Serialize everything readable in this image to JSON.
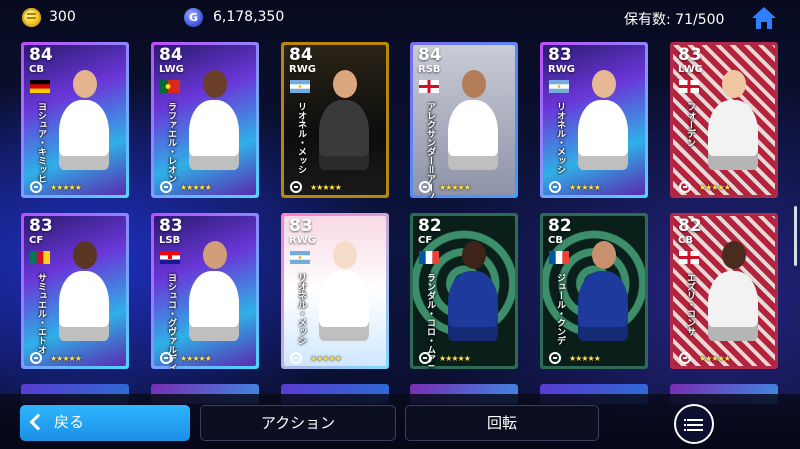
{
  "header": {
    "coins": "300",
    "gp": "6,178,350",
    "gp_icon_letter": "G",
    "holdings": "保有数: 71/500"
  },
  "cards": [
    {
      "rating": "84",
      "pos": "CB",
      "name": "ヨシュア・キミッヒ",
      "flag": "germany",
      "theme": "neon-purple"
    },
    {
      "rating": "84",
      "pos": "LWG",
      "name": "ラファエル・レオン",
      "flag": "portugal",
      "theme": "neon-purple"
    },
    {
      "rating": "84",
      "pos": "RWG",
      "name": "リオネル・メッシ",
      "flag": "argentina",
      "theme": "dark-gold"
    },
    {
      "rating": "84",
      "pos": "RSB",
      "name": "アレクサンダー＝アーノルド",
      "flag": "england",
      "theme": "grey-blue"
    },
    {
      "rating": "83",
      "pos": "RWG",
      "name": "リオネル・メッシ",
      "flag": "argentina",
      "theme": "neon-purple"
    },
    {
      "rating": "83",
      "pos": "LWG",
      "name": "フォーデン",
      "flag": "england",
      "theme": "red-pattern"
    },
    {
      "rating": "83",
      "pos": "CF",
      "name": "サミュエル・エトオ",
      "flag": "cameroon",
      "theme": "neon-purple"
    },
    {
      "rating": "83",
      "pos": "LSB",
      "name": "ヨシュコ・グヴァルディオル",
      "flag": "croatia",
      "theme": "neon-purple"
    },
    {
      "rating": "83",
      "pos": "RWG",
      "name": "リオネル・メッシ",
      "flag": "argentina",
      "theme": "anime"
    },
    {
      "rating": "82",
      "pos": "CF",
      "name": "ランダル・コロ・ムアニ",
      "flag": "france",
      "theme": "green-tunnel"
    },
    {
      "rating": "82",
      "pos": "CB",
      "name": "ジュール・クンデ",
      "flag": "france",
      "theme": "green-tunnel"
    },
    {
      "rating": "82",
      "pos": "CB",
      "name": "エズリ・コンサ",
      "flag": "england",
      "theme": "red-pattern"
    }
  ],
  "stars": "★★★★★",
  "buttons": {
    "back": "戻る",
    "action": "アクション",
    "rotate": "回転"
  },
  "icons": [
    "coin-icon",
    "gp-icon",
    "home-icon",
    "chevron-left-icon",
    "list-menu-icon",
    "efootball-logo-icon",
    "star-icon"
  ],
  "colors": {
    "accent_blue": "#1a9cf0",
    "star_yellow": "#ffe14a",
    "background": "#0a0f2a"
  }
}
